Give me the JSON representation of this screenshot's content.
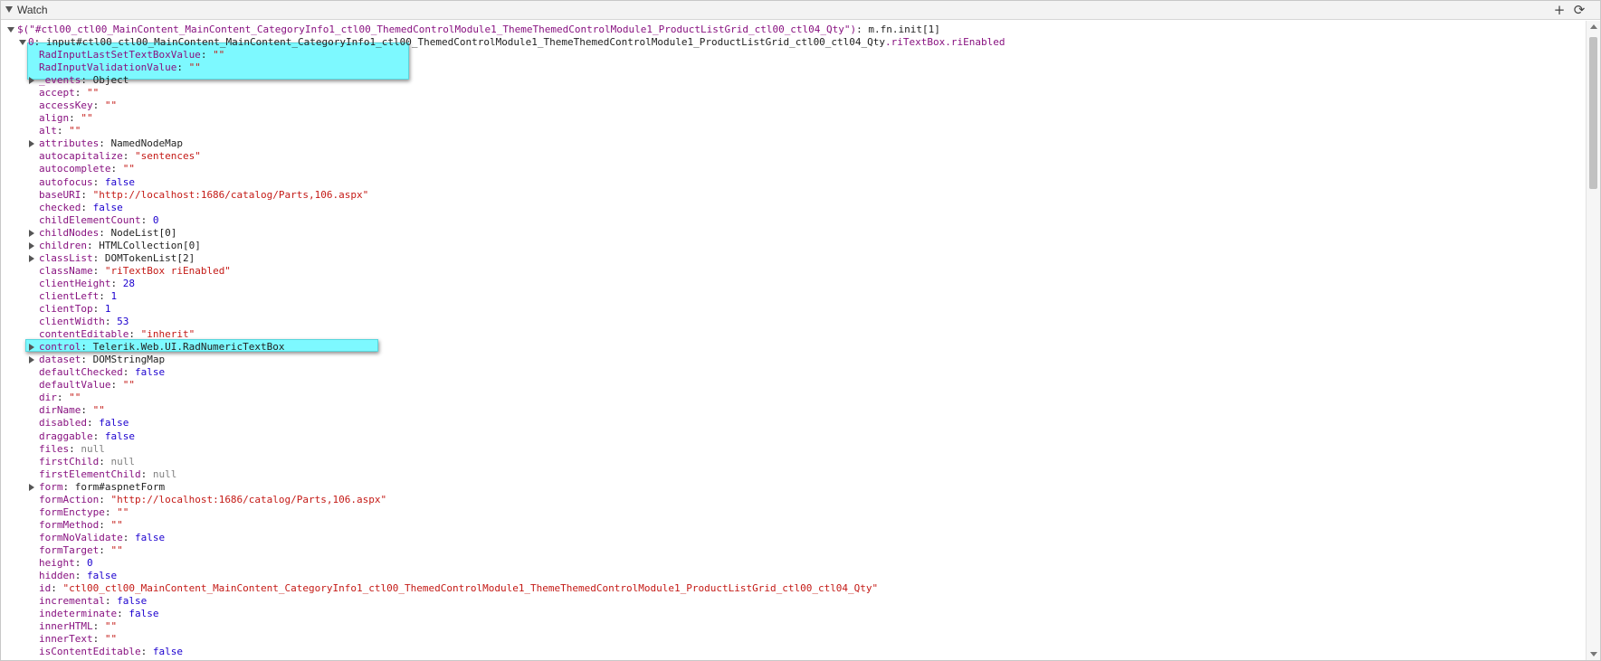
{
  "header": {
    "title": "Watch",
    "add_label": "+",
    "refresh_label": "⟳"
  },
  "expression": {
    "text": "$(\"#ctl00_ctl00_MainContent_MainContent_CategoryInfo1_ctl00_ThemedControlModule1_ThemeThemedControlModule1_ProductListGrid_ctl00_ctl04_Qty\")",
    "result": "m.fn.init[1]"
  },
  "node": {
    "index": "0",
    "text": "input#ctl00_ctl00_MainContent_MainContent_CategoryInfo1_ctl00_ThemedControlModule1_ThemeThemedControlModule1_ProductListGrid_ctl00_ctl04_Qty",
    "classes": ".riTextBox.riEnabled"
  },
  "properties": [
    {
      "key": "RadInputLastSetTextBoxValue",
      "value": "\"\"",
      "type": "string",
      "expandable": false
    },
    {
      "key": "RadInputValidationValue",
      "value": "\"\"",
      "type": "string",
      "expandable": false
    },
    {
      "key": "_events",
      "value": "Object",
      "type": "object",
      "expandable": true
    },
    {
      "key": "accept",
      "value": "\"\"",
      "type": "string",
      "expandable": false
    },
    {
      "key": "accessKey",
      "value": "\"\"",
      "type": "string",
      "expandable": false
    },
    {
      "key": "align",
      "value": "\"\"",
      "type": "string",
      "expandable": false
    },
    {
      "key": "alt",
      "value": "\"\"",
      "type": "string",
      "expandable": false
    },
    {
      "key": "attributes",
      "value": "NamedNodeMap",
      "type": "object",
      "expandable": true
    },
    {
      "key": "autocapitalize",
      "value": "\"sentences\"",
      "type": "string",
      "expandable": false
    },
    {
      "key": "autocomplete",
      "value": "\"\"",
      "type": "string",
      "expandable": false
    },
    {
      "key": "autofocus",
      "value": "false",
      "type": "bool",
      "expandable": false
    },
    {
      "key": "baseURI",
      "value": "\"http://localhost:1686/catalog/Parts,106.aspx\"",
      "type": "string",
      "expandable": false
    },
    {
      "key": "checked",
      "value": "false",
      "type": "bool",
      "expandable": false
    },
    {
      "key": "childElementCount",
      "value": "0",
      "type": "num",
      "expandable": false
    },
    {
      "key": "childNodes",
      "value": "NodeList[0]",
      "type": "object",
      "expandable": true
    },
    {
      "key": "children",
      "value": "HTMLCollection[0]",
      "type": "object",
      "expandable": true
    },
    {
      "key": "classList",
      "value": "DOMTokenList[2]",
      "type": "object",
      "expandable": true
    },
    {
      "key": "className",
      "value": "\"riTextBox riEnabled\"",
      "type": "string",
      "expandable": false
    },
    {
      "key": "clientHeight",
      "value": "28",
      "type": "num",
      "expandable": false
    },
    {
      "key": "clientLeft",
      "value": "1",
      "type": "num",
      "expandable": false
    },
    {
      "key": "clientTop",
      "value": "1",
      "type": "num",
      "expandable": false
    },
    {
      "key": "clientWidth",
      "value": "53",
      "type": "num",
      "expandable": false
    },
    {
      "key": "contentEditable",
      "value": "\"inherit\"",
      "type": "string",
      "expandable": false
    },
    {
      "key": "control",
      "value": "Telerik.Web.UI.RadNumericTextBox",
      "type": "object",
      "expandable": true
    },
    {
      "key": "dataset",
      "value": "DOMStringMap",
      "type": "object",
      "expandable": true
    },
    {
      "key": "defaultChecked",
      "value": "false",
      "type": "bool",
      "expandable": false
    },
    {
      "key": "defaultValue",
      "value": "\"\"",
      "type": "string",
      "expandable": false
    },
    {
      "key": "dir",
      "value": "\"\"",
      "type": "string",
      "expandable": false
    },
    {
      "key": "dirName",
      "value": "\"\"",
      "type": "string",
      "expandable": false
    },
    {
      "key": "disabled",
      "value": "false",
      "type": "bool",
      "expandable": false
    },
    {
      "key": "draggable",
      "value": "false",
      "type": "bool",
      "expandable": false
    },
    {
      "key": "files",
      "value": "null",
      "type": "null",
      "expandable": false
    },
    {
      "key": "firstChild",
      "value": "null",
      "type": "null",
      "expandable": false
    },
    {
      "key": "firstElementChild",
      "value": "null",
      "type": "null",
      "expandable": false
    },
    {
      "key": "form",
      "value": "form#aspnetForm",
      "type": "object",
      "expandable": true
    },
    {
      "key": "formAction",
      "value": "\"http://localhost:1686/catalog/Parts,106.aspx\"",
      "type": "string",
      "expandable": false
    },
    {
      "key": "formEnctype",
      "value": "\"\"",
      "type": "string",
      "expandable": false
    },
    {
      "key": "formMethod",
      "value": "\"\"",
      "type": "string",
      "expandable": false
    },
    {
      "key": "formNoValidate",
      "value": "false",
      "type": "bool",
      "expandable": false
    },
    {
      "key": "formTarget",
      "value": "\"\"",
      "type": "string",
      "expandable": false
    },
    {
      "key": "height",
      "value": "0",
      "type": "num",
      "expandable": false
    },
    {
      "key": "hidden",
      "value": "false",
      "type": "bool",
      "expandable": false
    },
    {
      "key": "id",
      "value": "\"ctl00_ctl00_MainContent_MainContent_CategoryInfo1_ctl00_ThemedControlModule1_ThemeThemedControlModule1_ProductListGrid_ctl00_ctl04_Qty\"",
      "type": "string",
      "expandable": false
    },
    {
      "key": "incremental",
      "value": "false",
      "type": "bool",
      "expandable": false
    },
    {
      "key": "indeterminate",
      "value": "false",
      "type": "bool",
      "expandable": false
    },
    {
      "key": "innerHTML",
      "value": "\"\"",
      "type": "string",
      "expandable": false
    },
    {
      "key": "innerText",
      "value": "\"\"",
      "type": "string",
      "expandable": false
    },
    {
      "key": "isContentEditable",
      "value": "false",
      "type": "bool",
      "expandable": false
    }
  ],
  "colors": {
    "key": "#881280",
    "string": "#c41a16",
    "number": "#1c00cf",
    "null": "#808080",
    "highlight": "#7df9ff"
  },
  "icons": {
    "collapse": "triangle-down-icon",
    "expand": "triangle-right-icon",
    "add": "plus-icon",
    "refresh": "refresh-icon"
  }
}
